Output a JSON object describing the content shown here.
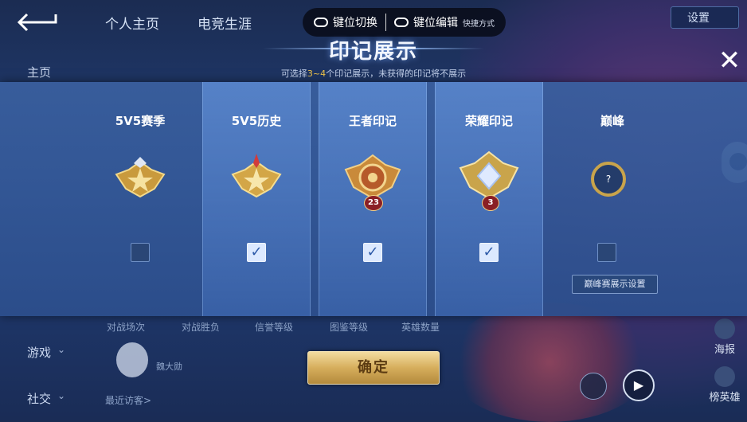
{
  "top_tabs": [
    "个人主页",
    "电竞生涯"
  ],
  "top_right": {
    "settings_label": "设置"
  },
  "sidebar": {
    "home": "主页",
    "games": "游戏",
    "social": "社交"
  },
  "keybar": {
    "switch_label": "键位切换",
    "edit_label": "键位编辑",
    "shortcut_label": "快捷方式"
  },
  "dialog": {
    "title": "印记展示",
    "subtitle_prefix": "可选择",
    "subtitle_highlight": "3~4",
    "subtitle_suffix": "个印记展示，未获得的印记将不展示",
    "columns": [
      {
        "label": "5V5赛季",
        "checked": false
      },
      {
        "label": "5V5历史",
        "checked": true
      },
      {
        "label": "王者印记",
        "checked": true,
        "badge_number": "23"
      },
      {
        "label": "荣耀印记",
        "checked": true,
        "badge_number": "3"
      },
      {
        "label": "巅峰",
        "checked": false,
        "badge_symbol": "?"
      }
    ],
    "peak_settings_label": "巅峰赛展示设置",
    "confirm_label": "确定",
    "checkmark": "✓",
    "close_symbol": "✕"
  },
  "background": {
    "stats": [
      "对战场次",
      "对战胜负",
      "信誉等级",
      "图鉴等级",
      "英雄数量"
    ],
    "player_name": "魏大勋",
    "recent_visitors": "最近访客>",
    "right_labels": [
      "海报",
      "榜英雄"
    ]
  },
  "colors": {
    "accent_gold": "#d6ae5c",
    "checkbox_on": "#dce9ff",
    "panel_bg": "#2c4e8c"
  }
}
